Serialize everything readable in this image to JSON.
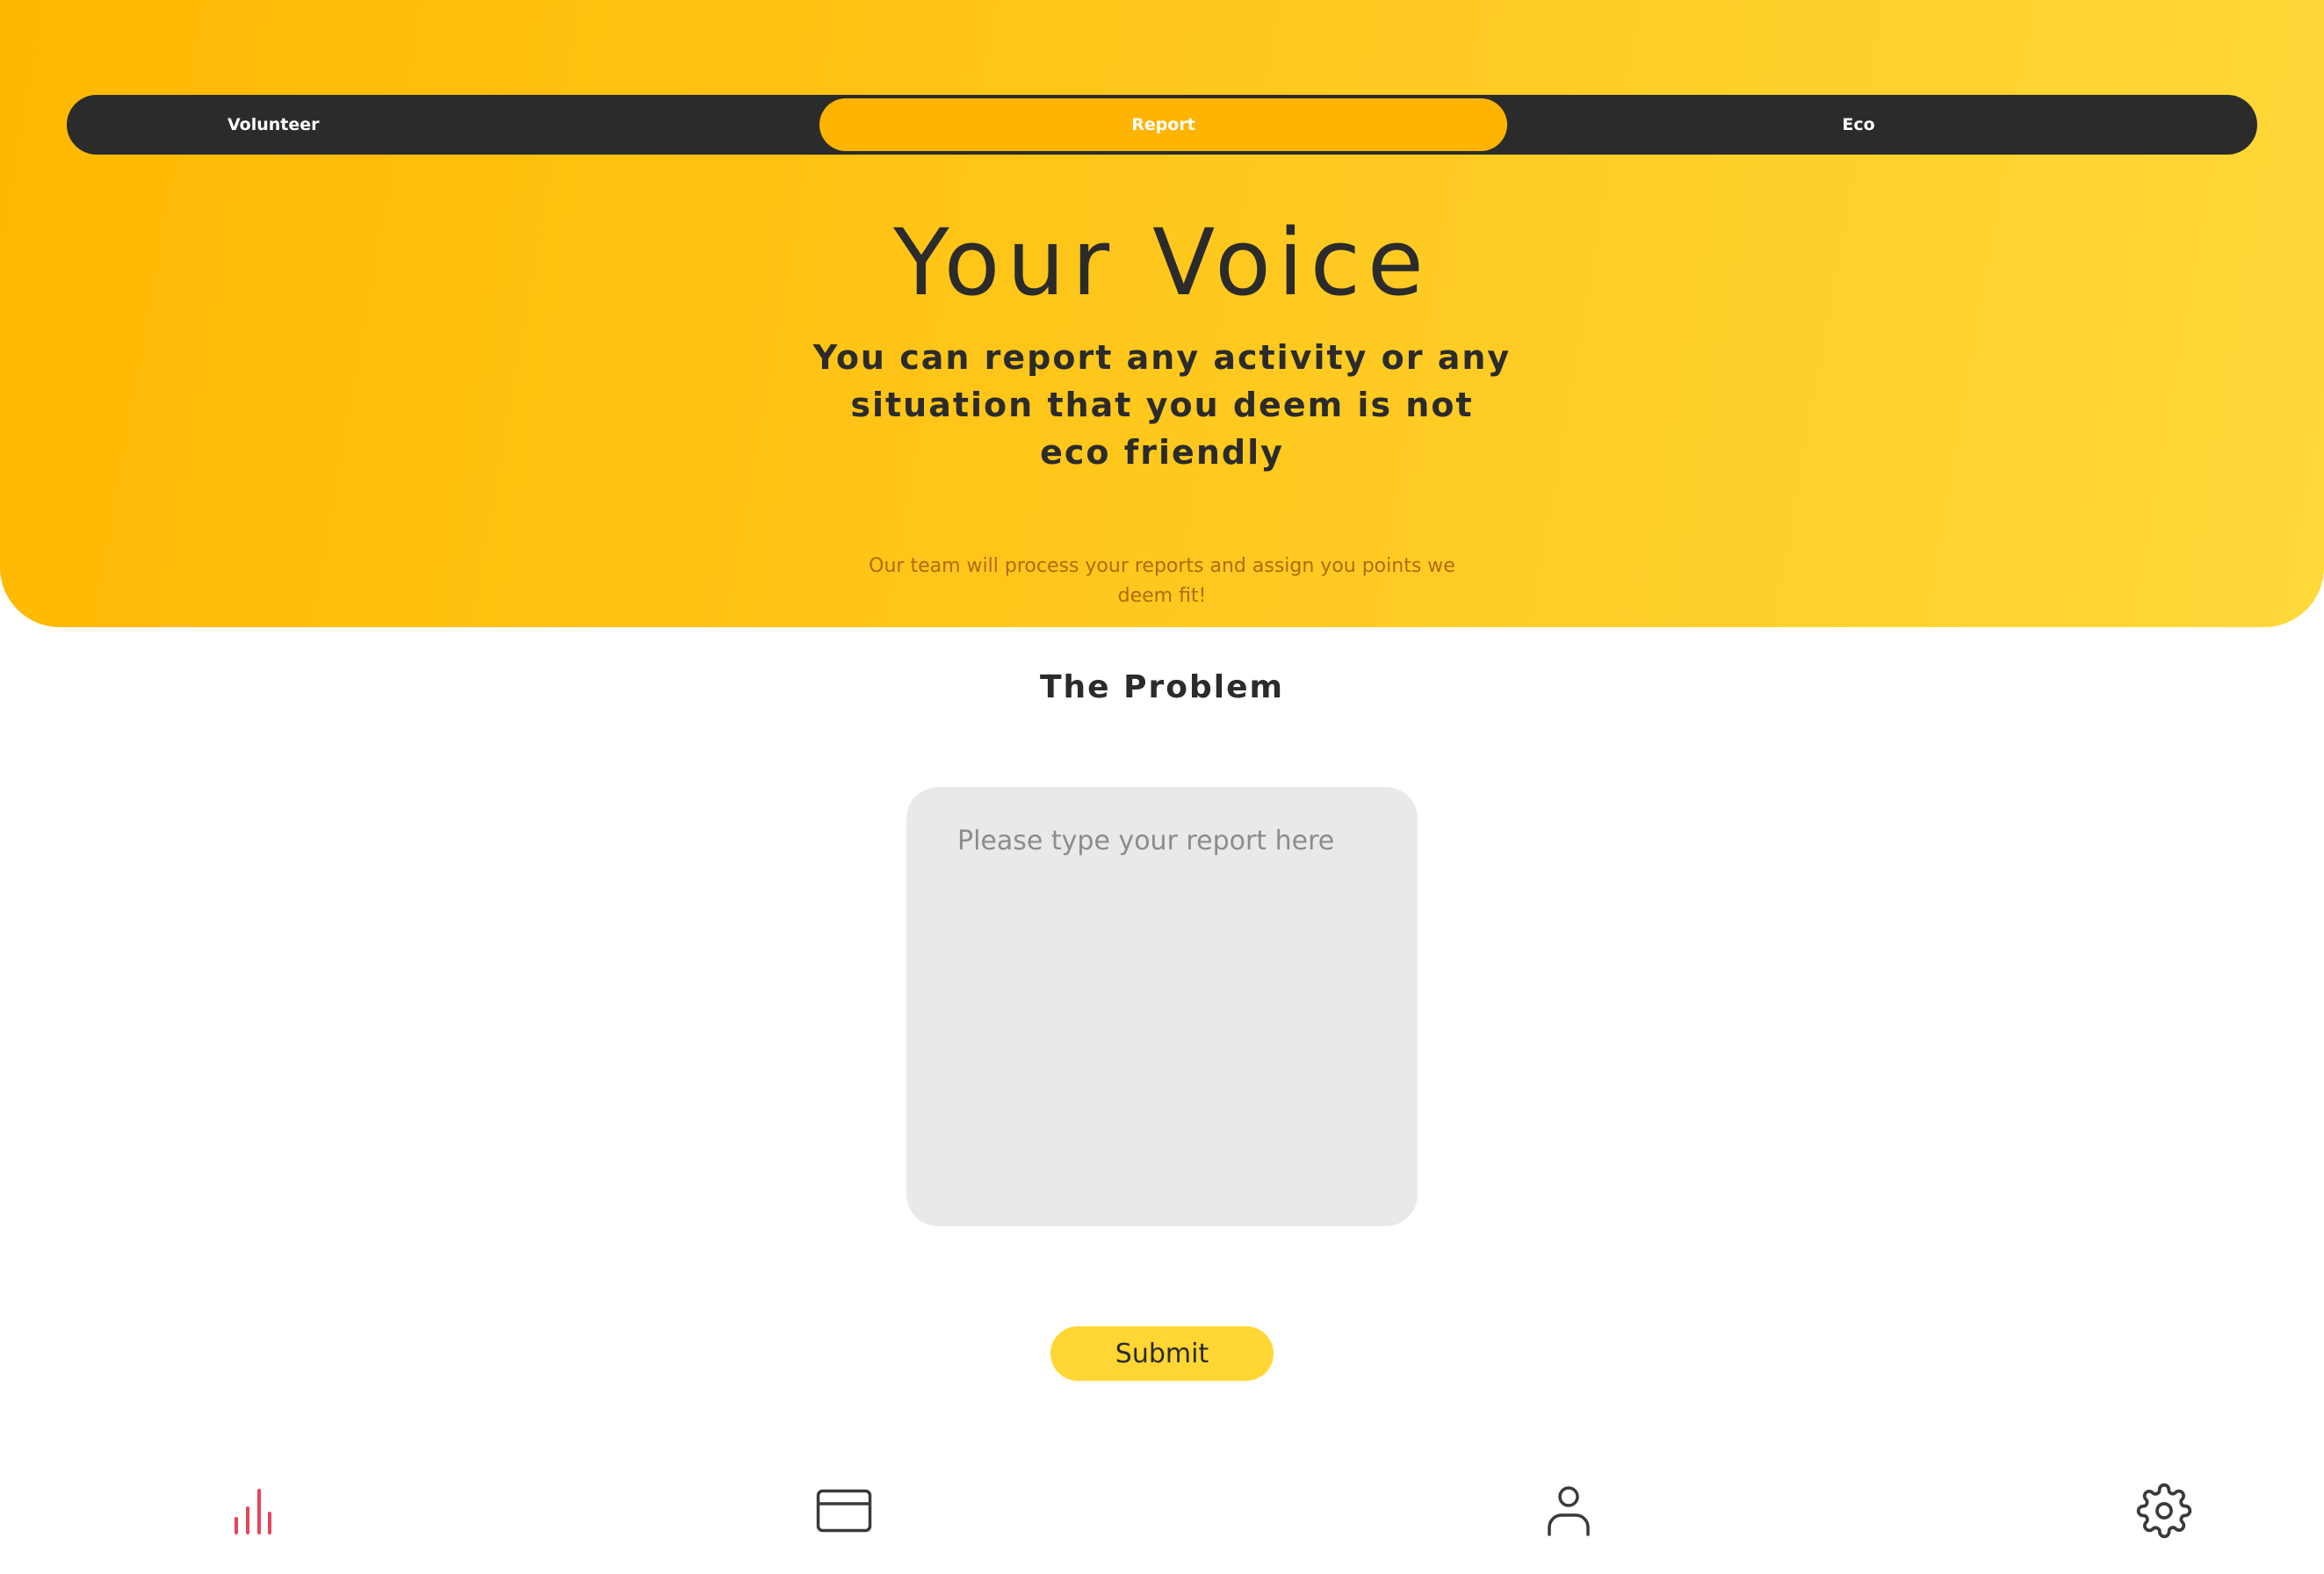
{
  "colors": {
    "accent": "#ffb400",
    "tabbar_bg": "#2b2b2b",
    "text_dark": "#2b2b2b",
    "note_text": "#b06a0c",
    "active_nav": "#e8455a",
    "submit_bg": "#ffd633",
    "input_bg": "#e9e9e9"
  },
  "tabs": [
    {
      "label": "Volunteer",
      "active": false
    },
    {
      "label": "Report",
      "active": true
    },
    {
      "label": "Eco",
      "active": false
    }
  ],
  "hero": {
    "title": "Your Voice",
    "subtitle": "You can report any activity or any situation that you deem is not eco friendly",
    "note": "Our team will process your reports and assign you points we deem fit!"
  },
  "form": {
    "heading": "The Problem",
    "placeholder": "Please type your report here",
    "value": "",
    "submit_label": "Submit"
  },
  "nav": [
    {
      "icon": "bar-chart-icon",
      "active": true
    },
    {
      "icon": "credit-card-icon",
      "active": false
    },
    {
      "icon": "user-icon",
      "active": false
    },
    {
      "icon": "gear-icon",
      "active": false
    }
  ]
}
